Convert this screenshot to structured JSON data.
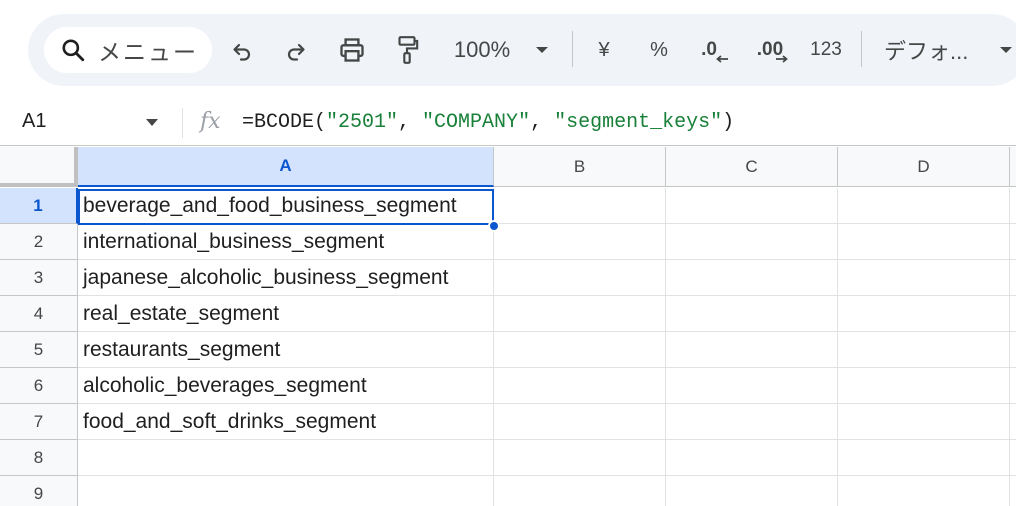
{
  "toolbar": {
    "menu_search_label": "メニュー",
    "zoom": "100%",
    "currency_symbol": "¥",
    "percent_symbol": "%",
    "decrease_decimal_label": ".0",
    "increase_decimal_label": ".00",
    "number_format_label": "123",
    "font_label": "デフォ..."
  },
  "formula_bar": {
    "name_box": "A1",
    "formula_prefix": "=BCODE(",
    "arg1": "\"2501\"",
    "sep1": ", ",
    "arg2": "\"COMPANY\"",
    "sep2": ", ",
    "arg3": "\"segment_keys\"",
    "formula_suffix": ")"
  },
  "grid": {
    "columns": [
      "A",
      "B",
      "C",
      "D"
    ],
    "rows": [
      "1",
      "2",
      "3",
      "4",
      "5",
      "6",
      "7",
      "8",
      "9"
    ],
    "cells_a": [
      "beverage_and_food_business_segment",
      "international_business_segment",
      "japanese_alcoholic_business_segment",
      "real_estate_segment",
      "restaurants_segment",
      "alcoholic_beverages_segment",
      "food_and_soft_drinks_segment",
      "",
      ""
    ]
  },
  "colors": {
    "accent": "#0b57d0",
    "selected_header_bg": "#d3e3fd",
    "formula_string": "#188038",
    "toolbar_bg": "#f0f4f9"
  },
  "icons": [
    "search-icon",
    "undo-icon",
    "redo-icon",
    "print-icon",
    "paint-format-icon",
    "dropdown-arrow-icon",
    "fx-icon"
  ]
}
